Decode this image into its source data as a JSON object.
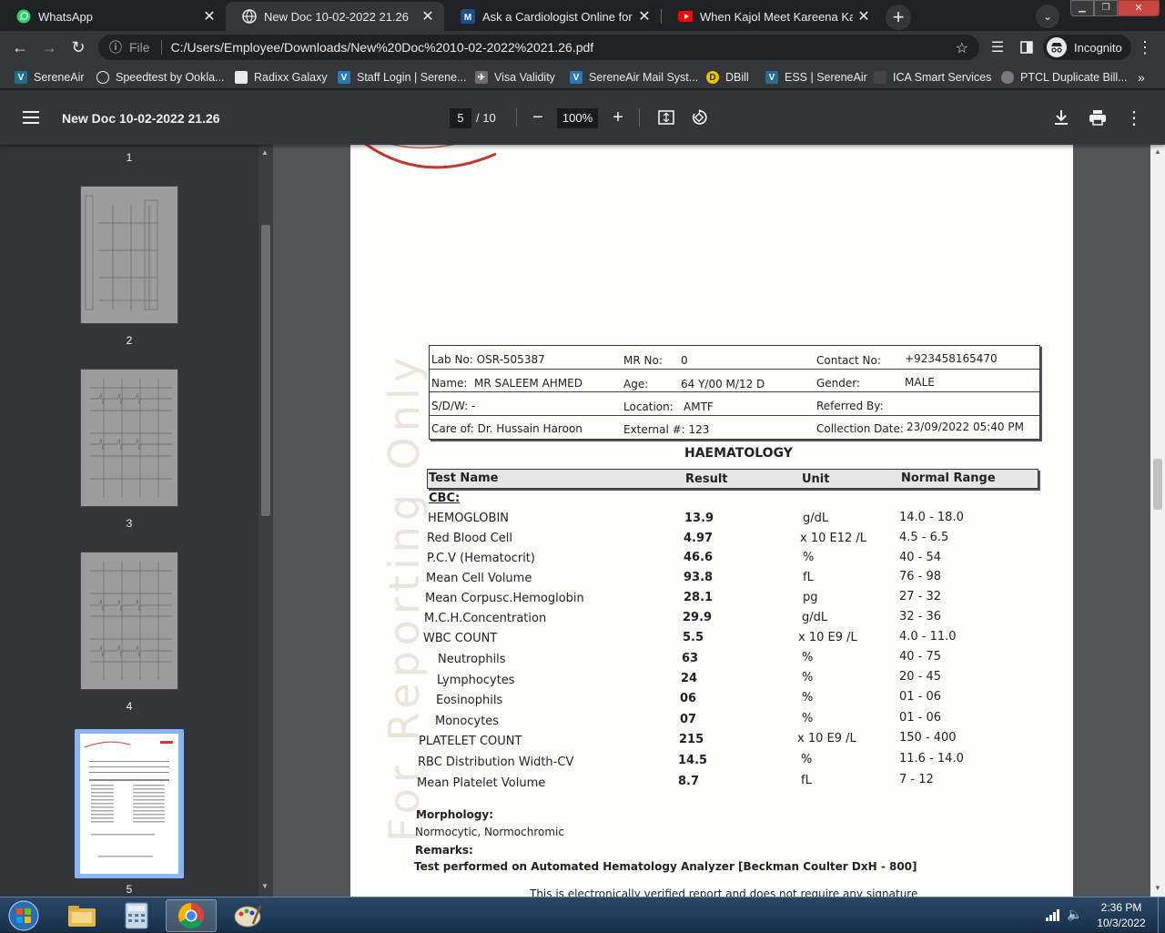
{
  "browser": {
    "tabs": [
      {
        "title": "WhatsApp",
        "icon": "whatsapp-icon"
      },
      {
        "title": "New Doc 10-02-2022 21.26",
        "icon": "globe-icon"
      },
      {
        "title": "Ask a Cardiologist Online for HEA",
        "icon": "m-icon"
      },
      {
        "title": "When Kajol Meet Kareena Kapoor",
        "icon": "youtube-icon"
      }
    ],
    "new_tab": "+",
    "url_scheme_label": "File",
    "url": "C:/Users/Employee/Downloads/New%20Doc%2010-02-2022%2021.26.pdf",
    "profile_label": "Incognito",
    "bookmarks": [
      "SereneAir",
      "Speedtest by Ookla...",
      "Radixx Galaxy",
      "Staff Login | Serene...",
      "Visa Validity",
      "SereneAir Mail Syst...",
      "DBill",
      "ESS | SereneAir",
      "ICA Smart Services",
      "PTCL Duplicate Bill..."
    ],
    "bookmarks_more": "»"
  },
  "pdf": {
    "doc_title": "New Doc 10-02-2022 21.26",
    "current_page": "5",
    "total_pages": "/ 10",
    "zoom": "100%",
    "thumbnails": [
      "1",
      "2",
      "3",
      "4",
      "5"
    ]
  },
  "report": {
    "header": {
      "lab_no_label": "Lab No:",
      "lab_no": "OSR-505387",
      "mr_no_label": "MR No:",
      "mr_no": "0",
      "contact_label": "Contact No:",
      "contact": "+923458165470",
      "name_label": "Name:",
      "name": "MR SALEEM AHMED",
      "age_label": "Age:",
      "age": "64 Y/00 M/12 D",
      "gender_label": "Gender:",
      "gender": "MALE",
      "sdw_label": "S/D/W:",
      "sdw": "-",
      "location_label": "Location:",
      "location": "AMTF",
      "referred_label": "Referred By:",
      "referred": "",
      "care_label": "Care of:",
      "care": "Dr. Hussain Haroon",
      "external_label": "External #:",
      "external": "123",
      "collection_label": "Collection Date:",
      "collection": "23/09/2022 05:40 PM"
    },
    "section": "HAEMATOLOGY",
    "columns": [
      "Test Name",
      "Result",
      "Unit",
      "Normal Range"
    ],
    "group": "CBC:",
    "rows": [
      {
        "name": "HEMOGLOBIN",
        "result": "13.9",
        "unit": "g/dL",
        "range": "14.0 - 18.0"
      },
      {
        "name": "Red Blood Cell",
        "result": "4.97",
        "unit": "x 10 E12 /L",
        "range": "4.5 - 6.5"
      },
      {
        "name": "P.C.V (Hematocrit)",
        "result": "46.6",
        "unit": "%",
        "range": "40 - 54"
      },
      {
        "name": "Mean Cell Volume",
        "result": "93.8",
        "unit": "fL",
        "range": "76 - 98"
      },
      {
        "name": "Mean Corpusc.Hemoglobin",
        "result": "28.1",
        "unit": "pg",
        "range": "27 - 32"
      },
      {
        "name": "M.C.H.Concentration",
        "result": "29.9",
        "unit": "g/dL",
        "range": "32 - 36"
      },
      {
        "name": "WBC COUNT",
        "result": "5.5",
        "unit": "x 10 E9 /L",
        "range": "4.0 - 11.0"
      },
      {
        "name": "Neutrophils",
        "result": "63",
        "unit": "%",
        "range": "40 - 75"
      },
      {
        "name": "Lymphocytes",
        "result": "24",
        "unit": "%",
        "range": "20 - 45"
      },
      {
        "name": "Eosinophils",
        "result": "06",
        "unit": "%",
        "range": "01 - 06"
      },
      {
        "name": "Monocytes",
        "result": "07",
        "unit": "%",
        "range": "01 - 06"
      },
      {
        "name": "PLATELET COUNT",
        "result": "215",
        "unit": "x 10 E9 /L",
        "range": "150 - 400"
      },
      {
        "name": "RBC Distribution Width-CV",
        "result": "14.5",
        "unit": "%",
        "range": "11.6 - 14.0"
      },
      {
        "name": "Mean Platelet Volume",
        "result": "8.7",
        "unit": "fL",
        "range": "7 - 12"
      }
    ],
    "morphology_label": "Morphology:",
    "morphology": "Normocytic, Normochromic",
    "remarks_label": "Remarks:",
    "remarks": "Test performed on Automated Hematology Analyzer [Beckman Coulter DxH - 800]",
    "watermark": "For Reporting Only",
    "footer_partial": "This is electronically verified report and does not require any signature"
  },
  "taskbar": {
    "time": "2:36 PM",
    "date": "10/3/2022"
  }
}
